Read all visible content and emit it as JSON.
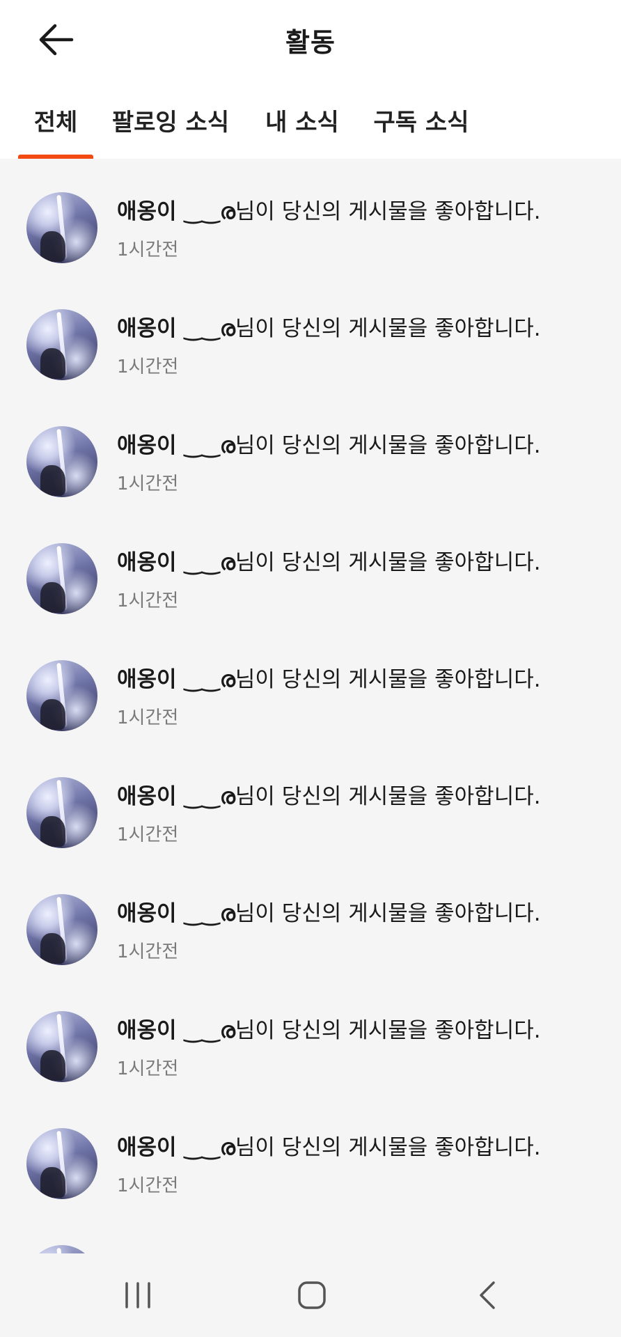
{
  "header": {
    "title": "활동",
    "back_icon": "arrow-left-icon"
  },
  "tabs": [
    {
      "label": "전체",
      "active": true
    },
    {
      "label": "팔로잉 소식",
      "active": false
    },
    {
      "label": "내 소식",
      "active": false
    },
    {
      "label": "구독 소식",
      "active": false
    }
  ],
  "accent_color": "#f24a12",
  "notifications": [
    {
      "name": "애옹이 ‿‿ര",
      "text": "님이 당신의 게시물을 좋아합니다.",
      "time": "1시간전"
    },
    {
      "name": "애옹이 ‿‿ര",
      "text": "님이 당신의 게시물을 좋아합니다.",
      "time": "1시간전"
    },
    {
      "name": "애옹이 ‿‿ര",
      "text": "님이 당신의 게시물을 좋아합니다.",
      "time": "1시간전"
    },
    {
      "name": "애옹이 ‿‿ര",
      "text": "님이 당신의 게시물을 좋아합니다.",
      "time": "1시간전"
    },
    {
      "name": "애옹이 ‿‿ര",
      "text": "님이 당신의 게시물을 좋아합니다.",
      "time": "1시간전"
    },
    {
      "name": "애옹이 ‿‿ര",
      "text": "님이 당신의 게시물을 좋아합니다.",
      "time": "1시간전"
    },
    {
      "name": "애옹이 ‿‿ര",
      "text": "님이 당신의 게시물을 좋아합니다.",
      "time": "1시간전"
    },
    {
      "name": "애옹이 ‿‿ര",
      "text": "님이 당신의 게시물을 좋아합니다.",
      "time": "1시간전"
    },
    {
      "name": "애옹이 ‿‿ര",
      "text": "님이 당신의 게시물을 좋아합니다.",
      "time": "1시간전"
    }
  ],
  "system_nav": {
    "recents_icon": "recent-apps-icon",
    "home_icon": "home-icon",
    "back_icon": "back-chevron-icon"
  }
}
